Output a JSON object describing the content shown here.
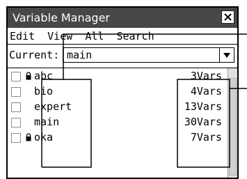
{
  "window": {
    "title": "Variable Manager",
    "close_icon": "close-icon"
  },
  "menu": [
    "Edit",
    "View",
    "All",
    "Search"
  ],
  "current": {
    "label": "Current:",
    "value": "main"
  },
  "variables": [
    {
      "name": "abc",
      "count": "3Vars",
      "locked": true
    },
    {
      "name": "bio",
      "count": "4Vars",
      "locked": false
    },
    {
      "name": "expert",
      "count": "13Vars",
      "locked": false
    },
    {
      "name": "main",
      "count": "30Vars",
      "locked": false
    },
    {
      "name": "oka",
      "count": "7Vars",
      "locked": true
    }
  ],
  "colors": {
    "titlebar": "#474747",
    "callout": "#000000"
  }
}
